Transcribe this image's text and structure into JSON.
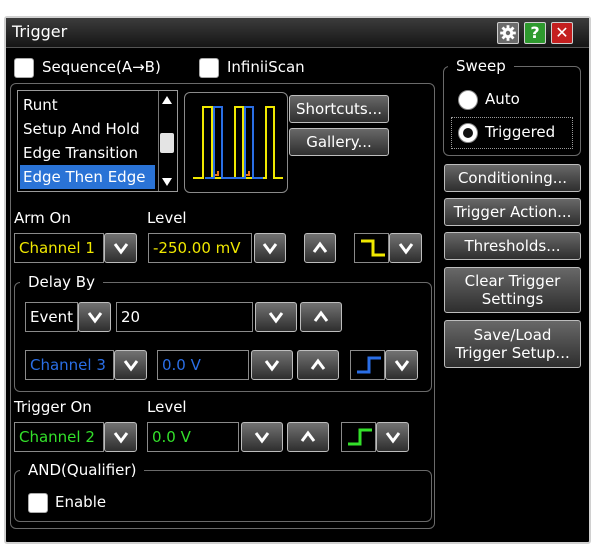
{
  "window": {
    "title": "Trigger",
    "help_label": "?",
    "close_label": "✕"
  },
  "options": {
    "sequence_label": "Sequence(A→B)",
    "infiniiscan_label": "InfiniiScan"
  },
  "trigger_types": {
    "items": [
      "Runt",
      "Setup And Hold",
      "Edge Transition",
      "Edge Then Edge"
    ],
    "selected": "Edge Then Edge"
  },
  "shortcuts_label": "Shortcuts...",
  "gallery_label": "Gallery...",
  "arm_on": {
    "label": "Arm On",
    "level_label": "Level",
    "source": "Channel 1",
    "level_value": "-250.00 mV",
    "slope": "falling"
  },
  "delay_by": {
    "title": "Delay By",
    "mode": "Event",
    "count": "20",
    "source": "Channel 3",
    "level_value": "0.0 V",
    "slope": "rising"
  },
  "trigger_on": {
    "label": "Trigger On",
    "level_label": "Level",
    "source": "Channel 2",
    "level_value": "0.0 V",
    "slope": "rising"
  },
  "qualifier": {
    "title": "AND(Qualifier)",
    "enable_label": "Enable"
  },
  "sweep": {
    "title": "Sweep",
    "options": [
      "Auto",
      "Triggered"
    ],
    "selected": "Triggered"
  },
  "side_buttons": {
    "conditioning": "Conditioning...",
    "trigger_action": "Trigger Action...",
    "thresholds": "Thresholds...",
    "clear_line1": "Clear Trigger",
    "clear_line2": "Settings",
    "saveload_line1": "Save/Load",
    "saveload_line2": "Trigger Setup..."
  },
  "colors": {
    "channel1": "#f0e800",
    "channel2": "#33e02a",
    "channel3": "#2a6ee6",
    "selection": "#2a73d6",
    "panel_border": "#6a6a6a"
  },
  "icons": {
    "settings": "gear-icon",
    "help": "question-icon",
    "close": "close-icon"
  }
}
